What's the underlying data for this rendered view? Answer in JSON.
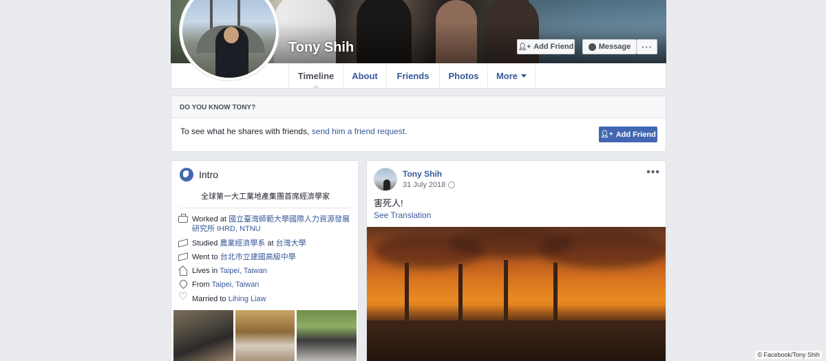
{
  "profile": {
    "name": "Tony Shih",
    "add_friend_label": "Add Friend",
    "message_label": "Message",
    "more_label": "···"
  },
  "nav": {
    "tabs": [
      {
        "label": "Timeline",
        "active": true
      },
      {
        "label": "About"
      },
      {
        "label": "Friends"
      },
      {
        "label": "Photos"
      },
      {
        "label": "More"
      }
    ]
  },
  "know_box": {
    "heading": "DO YOU KNOW TONY?",
    "text": "To see what he shares with friends, ",
    "link": "send him a friend request.",
    "button_label": "Add Friend"
  },
  "intro": {
    "title": "Intro",
    "bio": "全球第一大工業地產集團首席經濟學家",
    "rows": [
      {
        "icon": "briefcase-icon",
        "prefix": "Worked at ",
        "link": "國立臺灣師範大學國際人力資源發展研究所 IHRD, NTNU",
        "suffix": "",
        "link2": ""
      },
      {
        "icon": "graduation-cap-icon",
        "prefix": "Studied ",
        "link": "農業經濟學系",
        "suffix": " at ",
        "link2": "台灣大學"
      },
      {
        "icon": "graduation-cap-icon",
        "prefix": "Went to ",
        "link": "台北市立建國高級中學",
        "suffix": "",
        "link2": ""
      },
      {
        "icon": "home-icon",
        "prefix": "Lives in ",
        "link": "Taipei, Taiwan",
        "suffix": "",
        "link2": ""
      },
      {
        "icon": "location-pin-icon",
        "prefix": "From ",
        "link": "Taipei, Taiwan",
        "suffix": "",
        "link2": ""
      },
      {
        "icon": "heart-icon",
        "prefix": "Married to ",
        "link": "Lihing Liaw",
        "suffix": "",
        "link2": ""
      }
    ]
  },
  "post": {
    "author": "Tony Shih",
    "date": "31 July 2018",
    "text": "害死人!",
    "translate_label": "See Translation",
    "menu_label": "•••"
  },
  "credit": "© Facebook/Tony Shih"
}
